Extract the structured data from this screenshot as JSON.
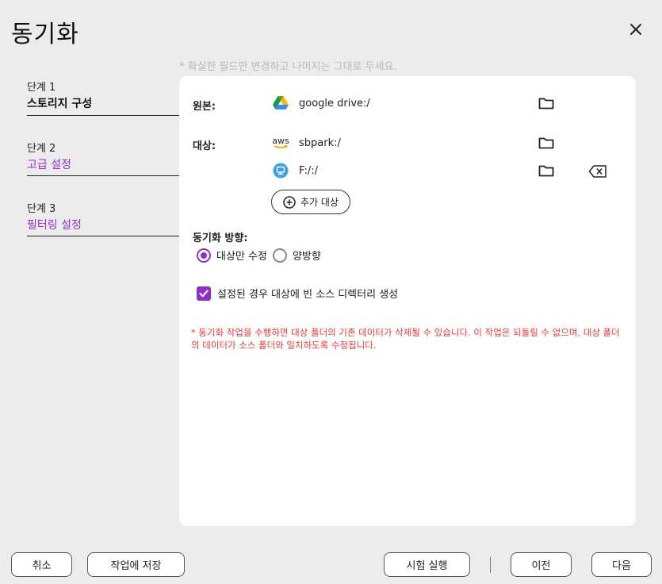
{
  "window": {
    "title": "동기화",
    "close_icon": "close-icon"
  },
  "hint": "* 확실한 필드만 변경하고 나머지는 그대로 두세요.",
  "steps": [
    {
      "num": "단계 1",
      "name": "스토리지 구성",
      "active": true
    },
    {
      "num": "단계 2",
      "name": "고급 설정",
      "active": false
    },
    {
      "num": "단계 3",
      "name": "필터링 설정",
      "active": false
    }
  ],
  "form": {
    "source_label": "원본:",
    "source": {
      "icon": "google-drive-icon",
      "path": "google drive:/"
    },
    "target_label": "대상:",
    "targets": [
      {
        "icon": "aws-icon",
        "icon_text": "aws",
        "path": "sbpark:/"
      },
      {
        "icon": "local-drive-icon",
        "path": "F:/:/"
      }
    ],
    "add_target_label": "추가 대상",
    "direction_label": "동기화 방향:",
    "direction_options": [
      {
        "label": "대상만 수정",
        "selected": true
      },
      {
        "label": "양방향",
        "selected": false
      }
    ],
    "create_empty_dirs_label": "설정된 경우 대상에 빈 소스 디렉터리 생성",
    "create_empty_dirs_checked": true,
    "warning": "* 동기화 작업을 수행하면 대상 폴더의 기존 데이터가 삭제될 수 있습니다. 이 작업은 되돌릴 수 없으며, 대상 폴더의 데이터가 소스 폴더와 일치하도록 수정됩니다."
  },
  "footer": {
    "cancel": "취소",
    "save_to_job": "작업에 저장",
    "test_run": "시험 실행",
    "previous": "이전",
    "next": "다음"
  },
  "colors": {
    "accent": "#8e2fc9",
    "warning": "#e23b3b",
    "background": "#ececec",
    "panel": "#ffffff"
  }
}
